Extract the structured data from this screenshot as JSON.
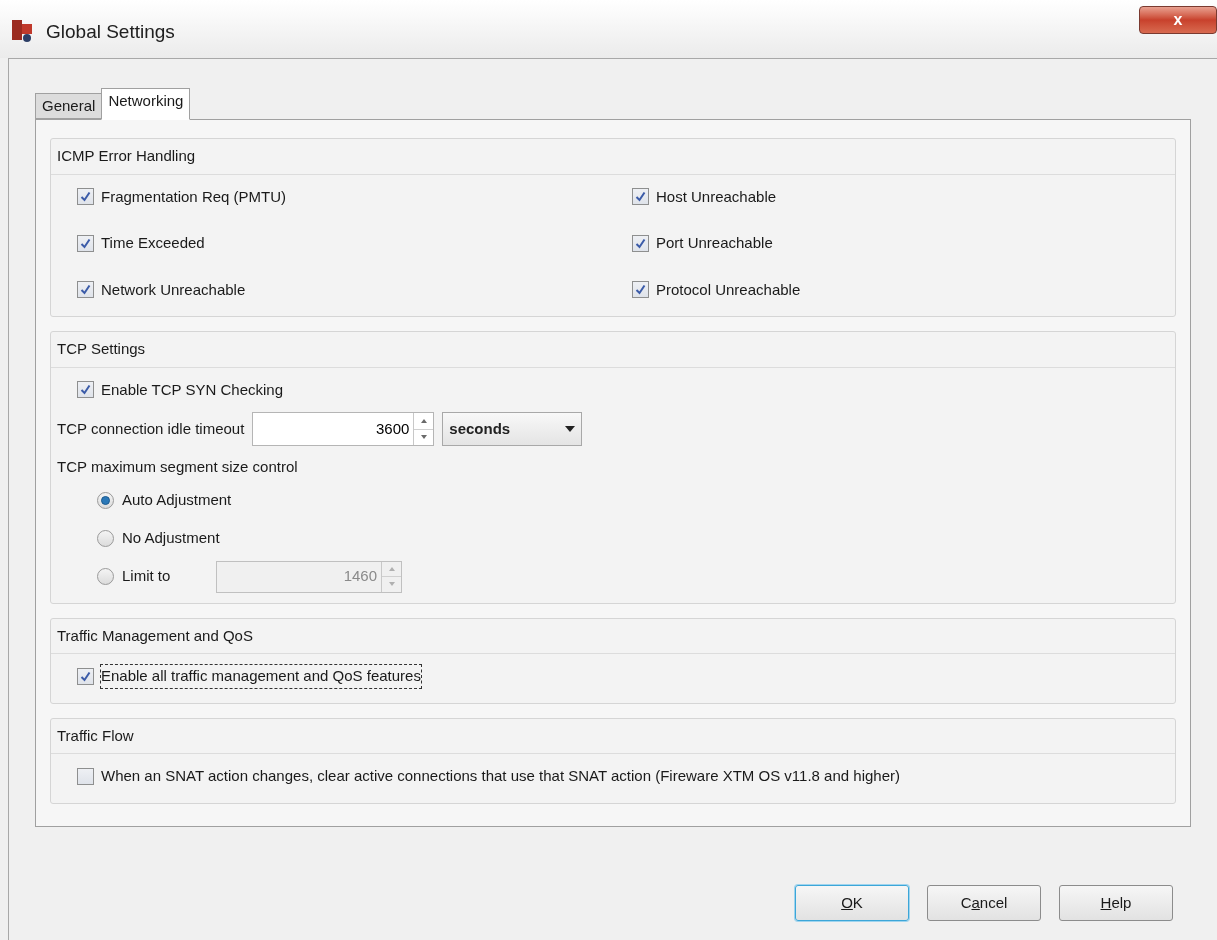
{
  "window": {
    "title": "Global Settings",
    "close": "x"
  },
  "tabs": [
    {
      "label": "General",
      "selected": false
    },
    {
      "label": "Networking",
      "selected": true
    }
  ],
  "icmp": {
    "title": "ICMP Error Handling",
    "items": [
      {
        "label": "Fragmentation Req (PMTU)",
        "checked": true
      },
      {
        "label": "Host Unreachable",
        "checked": true
      },
      {
        "label": "Time Exceeded",
        "checked": true
      },
      {
        "label": "Port Unreachable",
        "checked": true
      },
      {
        "label": "Network Unreachable",
        "checked": true
      },
      {
        "label": "Protocol Unreachable",
        "checked": true
      }
    ]
  },
  "tcp": {
    "title": "TCP Settings",
    "syn": {
      "label": "Enable TCP SYN Checking",
      "checked": true
    },
    "timeout_label": "TCP connection idle timeout",
    "timeout_value": "3600",
    "timeout_unit": "seconds",
    "mss_label": "TCP maximum segment size control",
    "mss_options": [
      {
        "label": "Auto Adjustment",
        "selected": true
      },
      {
        "label": "No Adjustment",
        "selected": false
      },
      {
        "label": "Limit to",
        "selected": false,
        "value": "1460",
        "disabled": true
      }
    ]
  },
  "traffic_management": {
    "title": "Traffic Management and QoS",
    "item": {
      "label": "Enable all traffic management and QoS features",
      "checked": true,
      "focused": true
    }
  },
  "traffic_flow": {
    "title": "Traffic Flow",
    "item": {
      "label": "When an SNAT action changes, clear active connections that use that SNAT action (Fireware XTM OS v11.8 and higher)",
      "checked": false
    }
  },
  "buttons": [
    {
      "parts": [
        {
          "text": "O",
          "underline": true
        },
        {
          "text": "K",
          "underline": false
        }
      ],
      "default": true
    },
    {
      "parts": [
        {
          "text": "C",
          "underline": false
        },
        {
          "text": "a",
          "underline": true
        },
        {
          "text": "ncel",
          "underline": false
        }
      ],
      "default": false
    },
    {
      "parts": [
        {
          "text": "H",
          "underline": true
        },
        {
          "text": "elp",
          "underline": false
        }
      ],
      "default": false
    }
  ]
}
